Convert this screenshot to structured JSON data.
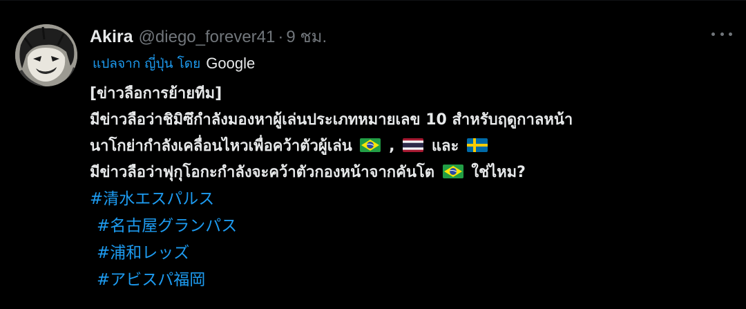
{
  "tweet": {
    "display_name": "Akira",
    "handle": "@diego_forever41",
    "separator": "·",
    "time": "9 ชม.",
    "translated_label": "แปลจาก ญี่ปุ่น โดย",
    "translated_by": "Google",
    "lines": {
      "l1": "[ข่าวลือการย้ายทีม]",
      "l2": "มีข่าวลือว่าชิมิซึกำลังมองหาผู้เล่นประเภทหมายเลข 10 สำหรับฤดูกาลหน้า",
      "l3a": "นาโกย่ากำลังเคลื่อนไหวเพื่อคว้าตัวผู้เล่น",
      "l3b": ",",
      "l3c": "และ",
      "l4a": "มีข่าวลือว่าฟุกุโอกะกำลังจะคว้าตัวกองหน้าจากคันโต",
      "l4b": "ใช่ไหม?"
    },
    "hashtags": [
      "#清水エスパルス",
      "#名古屋グランパス",
      "#浦和レッズ",
      "#アビスパ福岡"
    ],
    "flags": [
      "brazil-flag",
      "thailand-flag",
      "sweden-flag",
      "brazil-flag"
    ]
  },
  "colors": {
    "background": "#000000",
    "text": "#e7e9ea",
    "muted": "#71767b",
    "link": "#1d9bf0"
  }
}
